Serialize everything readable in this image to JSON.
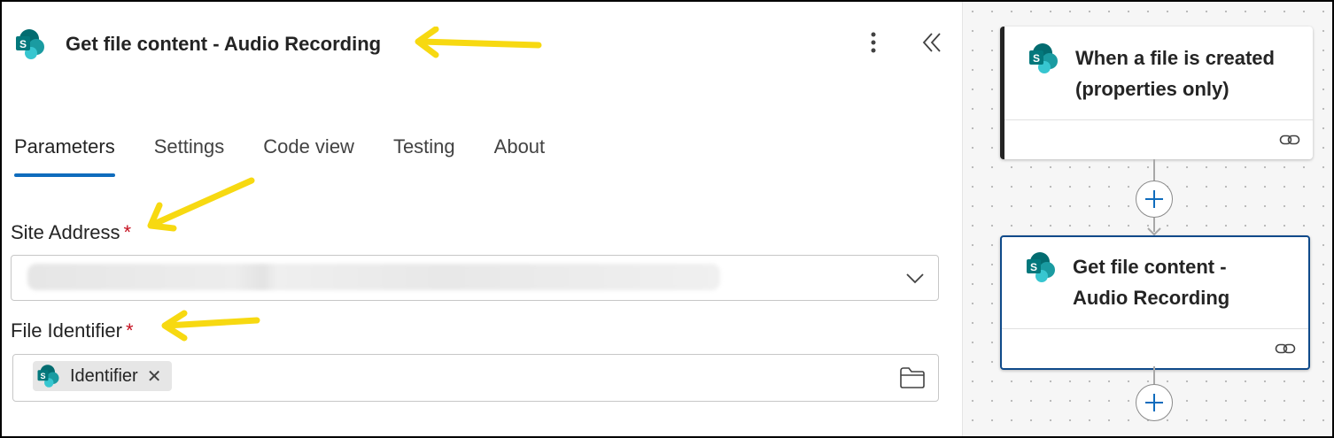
{
  "panel": {
    "title": "Get file content - Audio Recording",
    "tabs": [
      {
        "label": "Parameters",
        "active": true
      },
      {
        "label": "Settings",
        "active": false
      },
      {
        "label": "Code view",
        "active": false
      },
      {
        "label": "Testing",
        "active": false
      },
      {
        "label": "About",
        "active": false
      }
    ],
    "site_address": {
      "label": "Site Address",
      "required_mark": "*",
      "value": ""
    },
    "file_identifier": {
      "label": "File Identifier",
      "required_mark": "*",
      "token": {
        "label": "Identifier",
        "remove_glyph": "✕"
      }
    }
  },
  "canvas": {
    "cards": [
      {
        "title_line1": "When a file is created",
        "title_line2": "(properties only)"
      },
      {
        "title_line1": "Get file content -",
        "title_line2": "Audio Recording"
      }
    ]
  },
  "colors": {
    "accent": "#0f6cbd",
    "required": "#c50f1f",
    "sharepoint_dark": "#036c70",
    "sharepoint_mid": "#1a9ba1",
    "sharepoint_light": "#37c6d0",
    "annotation_arrow": "#f7d911"
  },
  "icons": {
    "action": "sharepoint-icon",
    "menu": "more-vertical-icon",
    "collapse": "double-chevron-left-icon",
    "dropdown": "chevron-down-icon",
    "browse": "folder-icon",
    "card_footer": "link-icon",
    "insert": "plus-icon"
  }
}
